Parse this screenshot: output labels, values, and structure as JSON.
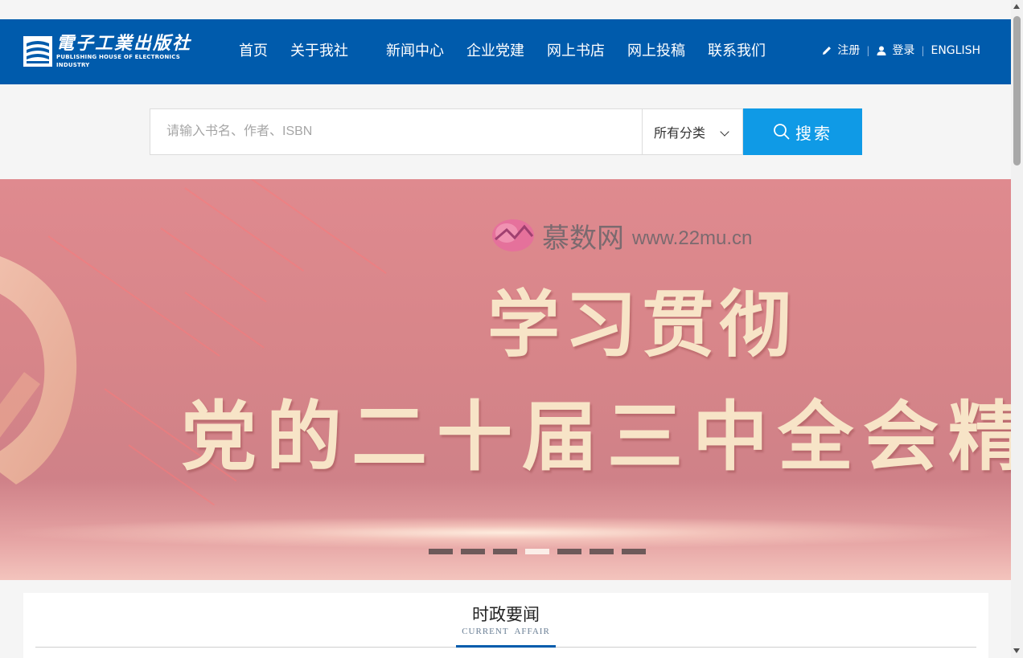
{
  "header": {
    "logo": {
      "cn": "電子工業出版社",
      "en": "PUBLISHING HOUSE OF ELECTRONICS INDUSTRY"
    },
    "nav": [
      "首页",
      "关于我社",
      "新闻中心",
      "企业党建",
      "网上书店",
      "网上投稿",
      "联系我们"
    ],
    "register_label": "注册",
    "login_label": "登录",
    "english_label": "ENGLISH",
    "separator": "|",
    "brand_color": "#005bac"
  },
  "search": {
    "placeholder": "请输入书名、作者、ISBN",
    "value": "",
    "category_selected": "所有分类",
    "button_label": "搜索",
    "button_color": "#0f9ae6"
  },
  "banner": {
    "watermark_cn": "慕数网",
    "watermark_url": "www.22mu.cn",
    "line1": "学习贯彻",
    "line2": "党的二十届三中全会精",
    "slide_count": 7,
    "active_slide": 4
  },
  "section": {
    "title": "时政要闻",
    "subtitle": "CURRENT AFFAIR"
  }
}
